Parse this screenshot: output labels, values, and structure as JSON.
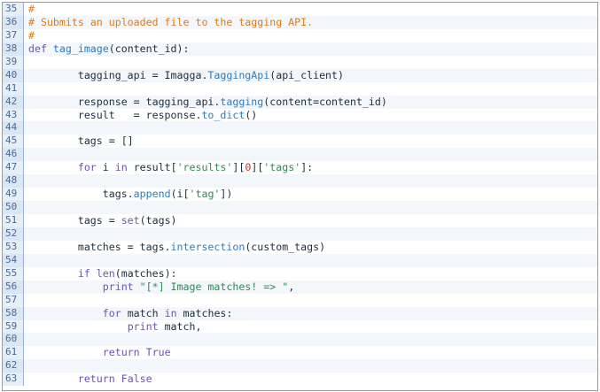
{
  "code_lines": [
    {
      "n": "35",
      "parts": [
        {
          "t": "#",
          "c": "cm"
        }
      ]
    },
    {
      "n": "36",
      "parts": [
        {
          "t": "# Submits an uploaded file to the tagging API.",
          "c": "cm"
        }
      ]
    },
    {
      "n": "37",
      "parts": [
        {
          "t": "#",
          "c": "cm"
        }
      ]
    },
    {
      "n": "38",
      "parts": [
        {
          "t": "def ",
          "c": "kw"
        },
        {
          "t": "tag_image",
          "c": "fn"
        },
        {
          "t": "(content_id):",
          "c": ""
        }
      ]
    },
    {
      "n": "39",
      "parts": []
    },
    {
      "n": "40",
      "parts": [
        {
          "t": "        tagging_api = Imagga.",
          "c": ""
        },
        {
          "t": "TaggingApi",
          "c": "fn"
        },
        {
          "t": "(api_client)",
          "c": ""
        }
      ]
    },
    {
      "n": "41",
      "parts": []
    },
    {
      "n": "42",
      "parts": [
        {
          "t": "        response = tagging_api.",
          "c": ""
        },
        {
          "t": "tagging",
          "c": "fn"
        },
        {
          "t": "(content=content_id)",
          "c": ""
        }
      ]
    },
    {
      "n": "43",
      "parts": [
        {
          "t": "        result   = response.",
          "c": ""
        },
        {
          "t": "to_dict",
          "c": "fn"
        },
        {
          "t": "()",
          "c": ""
        }
      ]
    },
    {
      "n": "44",
      "parts": []
    },
    {
      "n": "45",
      "parts": [
        {
          "t": "        tags = []",
          "c": ""
        }
      ]
    },
    {
      "n": "46",
      "parts": []
    },
    {
      "n": "47",
      "parts": [
        {
          "t": "        ",
          "c": ""
        },
        {
          "t": "for",
          "c": "kw"
        },
        {
          "t": " i ",
          "c": ""
        },
        {
          "t": "in",
          "c": "kw"
        },
        {
          "t": " result[",
          "c": ""
        },
        {
          "t": "'results'",
          "c": "str"
        },
        {
          "t": "][",
          "c": ""
        },
        {
          "t": "0",
          "c": "num-lit"
        },
        {
          "t": "][",
          "c": ""
        },
        {
          "t": "'tags'",
          "c": "str"
        },
        {
          "t": "]:",
          "c": ""
        }
      ]
    },
    {
      "n": "48",
      "parts": []
    },
    {
      "n": "49",
      "parts": [
        {
          "t": "            tags.",
          "c": ""
        },
        {
          "t": "append",
          "c": "fn"
        },
        {
          "t": "(i[",
          "c": ""
        },
        {
          "t": "'tag'",
          "c": "str"
        },
        {
          "t": "])",
          "c": ""
        }
      ]
    },
    {
      "n": "50",
      "parts": []
    },
    {
      "n": "51",
      "parts": [
        {
          "t": "        tags = ",
          "c": ""
        },
        {
          "t": "set",
          "c": "kw"
        },
        {
          "t": "(tags)",
          "c": ""
        }
      ]
    },
    {
      "n": "52",
      "parts": []
    },
    {
      "n": "53",
      "parts": [
        {
          "t": "        matches = tags.",
          "c": ""
        },
        {
          "t": "intersection",
          "c": "fn"
        },
        {
          "t": "(custom_tags)",
          "c": ""
        }
      ]
    },
    {
      "n": "54",
      "parts": []
    },
    {
      "n": "55",
      "parts": [
        {
          "t": "        ",
          "c": ""
        },
        {
          "t": "if",
          "c": "kw"
        },
        {
          "t": " ",
          "c": ""
        },
        {
          "t": "len",
          "c": "kw"
        },
        {
          "t": "(matches):",
          "c": ""
        }
      ]
    },
    {
      "n": "56",
      "parts": [
        {
          "t": "            ",
          "c": ""
        },
        {
          "t": "print",
          "c": "kw"
        },
        {
          "t": " ",
          "c": ""
        },
        {
          "t": "\"[*] Image matches! => \"",
          "c": "str"
        },
        {
          "t": ",",
          "c": ""
        }
      ]
    },
    {
      "n": "57",
      "parts": []
    },
    {
      "n": "58",
      "parts": [
        {
          "t": "            ",
          "c": ""
        },
        {
          "t": "for",
          "c": "kw"
        },
        {
          "t": " match ",
          "c": ""
        },
        {
          "t": "in",
          "c": "kw"
        },
        {
          "t": " matches:",
          "c": ""
        }
      ]
    },
    {
      "n": "59",
      "parts": [
        {
          "t": "                ",
          "c": ""
        },
        {
          "t": "print",
          "c": "kw"
        },
        {
          "t": " match,",
          "c": ""
        }
      ]
    },
    {
      "n": "60",
      "parts": []
    },
    {
      "n": "61",
      "parts": [
        {
          "t": "            ",
          "c": ""
        },
        {
          "t": "return",
          "c": "kw"
        },
        {
          "t": " ",
          "c": ""
        },
        {
          "t": "True",
          "c": "kw"
        }
      ]
    },
    {
      "n": "62",
      "parts": []
    },
    {
      "n": "63",
      "parts": [
        {
          "t": "        ",
          "c": ""
        },
        {
          "t": "return",
          "c": "kw"
        },
        {
          "t": " ",
          "c": ""
        },
        {
          "t": "False",
          "c": "kw"
        }
      ]
    }
  ]
}
